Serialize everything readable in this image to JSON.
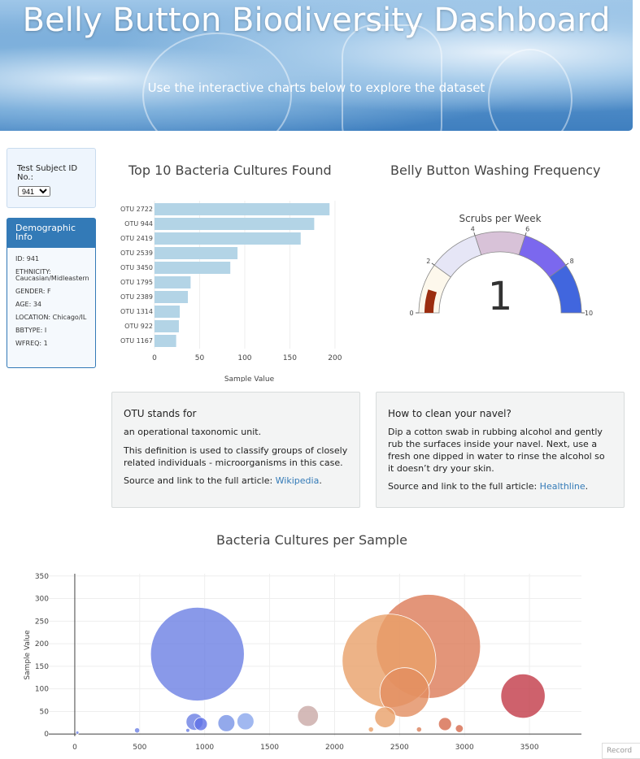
{
  "header": {
    "title": "Belly Button Biodiversity Dashboard",
    "subtitle": "Use the interactive charts below to explore the dataset"
  },
  "selector": {
    "label": "Test Subject ID No.:",
    "value": "941"
  },
  "demographics": {
    "title": "Demographic Info",
    "items": [
      "ID: 941",
      "ETHNICITY: Caucasian/Midleastern",
      "GENDER: F",
      "AGE: 34",
      "LOCATION: Chicago/IL",
      "BBTYPE: I",
      "WFREQ: 1"
    ]
  },
  "bar_chart_title": "Top 10 Bacteria Cultures Found",
  "gauge_title": "Belly Button Washing Frequency",
  "bubble_title": "Bacteria Cultures per Sample",
  "info_otu": {
    "title": "OTU stands for",
    "line1": "an operational taxonomic unit.",
    "line2": "This definition is used to classify groups of closely related individuals - microorganisms in this case.",
    "source_prefix": "Source and link to the full article:",
    "link": "Wikipedia",
    "suffix": "."
  },
  "info_navel": {
    "title": "How to clean your navel?",
    "line1": "Dip a cotton swab in rubbing alcohol and gently rub the surfaces inside your navel. Next, use a fresh one dipped in water to rinse the alcohol so it doesn’t dry your skin.",
    "source_prefix": "Source and link to the full article:",
    "link": "Healthline",
    "suffix": "."
  },
  "record_label": "Record",
  "colors": {
    "bar": "#b3d4e6",
    "accent": "#337ab7",
    "gauge_needle": "#9b2d0f"
  },
  "chart_data": [
    {
      "type": "bar",
      "orientation": "horizontal",
      "categories": [
        "OTU 2722",
        "OTU 944",
        "OTU 2419",
        "OTU 2539",
        "OTU 3450",
        "OTU 1795",
        "OTU 2389",
        "OTU 1314",
        "OTU 922",
        "OTU 1167"
      ],
      "values": [
        194,
        177,
        162,
        92,
        84,
        40,
        37,
        28,
        27,
        24
      ],
      "xlabel": "Sample Value",
      "xlim": [
        0,
        210
      ],
      "xticks": [
        0,
        50,
        100,
        150,
        200
      ]
    },
    {
      "type": "gauge",
      "title": "Scrubs per Week",
      "value": 1,
      "range": [
        0,
        10
      ],
      "ticks": [
        0,
        2,
        4,
        6,
        8,
        10
      ],
      "step_colors": [
        "#fdf8ec",
        "#e6e6f6",
        "#d8c2d8",
        "#7b68ee",
        "#4166de"
      ]
    },
    {
      "type": "scatter",
      "subtype": "bubble",
      "ylabel": "Sample Value",
      "xlim": [
        -200,
        3900
      ],
      "ylim": [
        -5,
        355
      ],
      "xticks": [
        0,
        500,
        1000,
        1500,
        2000,
        2500,
        3000,
        3500
      ],
      "yticks": [
        0,
        50,
        100,
        150,
        200,
        250,
        300,
        350
      ],
      "points": [
        {
          "x": 944,
          "y": 177,
          "r": 36,
          "color": "#6b7fe3"
        },
        {
          "x": 2722,
          "y": 194,
          "r": 40,
          "color": "#dc7a58"
        },
        {
          "x": 2419,
          "y": 162,
          "r": 36,
          "color": "#e8a069"
        },
        {
          "x": 2539,
          "y": 92,
          "r": 19,
          "color": "#e28d60"
        },
        {
          "x": 3450,
          "y": 84,
          "r": 17,
          "color": "#c23a47"
        },
        {
          "x": 1795,
          "y": 40,
          "r": 8,
          "color": "#c9a9a6"
        },
        {
          "x": 2389,
          "y": 37,
          "r": 8,
          "color": "#e8a069"
        },
        {
          "x": 1314,
          "y": 28,
          "r": 6.5,
          "color": "#8aa6ec"
        },
        {
          "x": 922,
          "y": 27,
          "r": 6.5,
          "color": "#6b7fe3"
        },
        {
          "x": 1167,
          "y": 24,
          "r": 6.5,
          "color": "#7893e6"
        },
        {
          "x": 970,
          "y": 22,
          "r": 5,
          "color": "#5f70e6"
        },
        {
          "x": 2850,
          "y": 22,
          "r": 5,
          "color": "#d66a4c"
        },
        {
          "x": 2960,
          "y": 12,
          "r": 3,
          "color": "#d66a4c"
        },
        {
          "x": 2650,
          "y": 10,
          "r": 2,
          "color": "#d9805a"
        },
        {
          "x": 2280,
          "y": 10,
          "r": 2,
          "color": "#e8a069"
        },
        {
          "x": 480,
          "y": 8,
          "r": 2,
          "color": "#6b7fe3"
        },
        {
          "x": 20,
          "y": 3,
          "r": 1.2,
          "color": "#6b7fe3"
        },
        {
          "x": 870,
          "y": 8,
          "r": 1.5,
          "color": "#6b7fe3"
        }
      ]
    }
  ]
}
